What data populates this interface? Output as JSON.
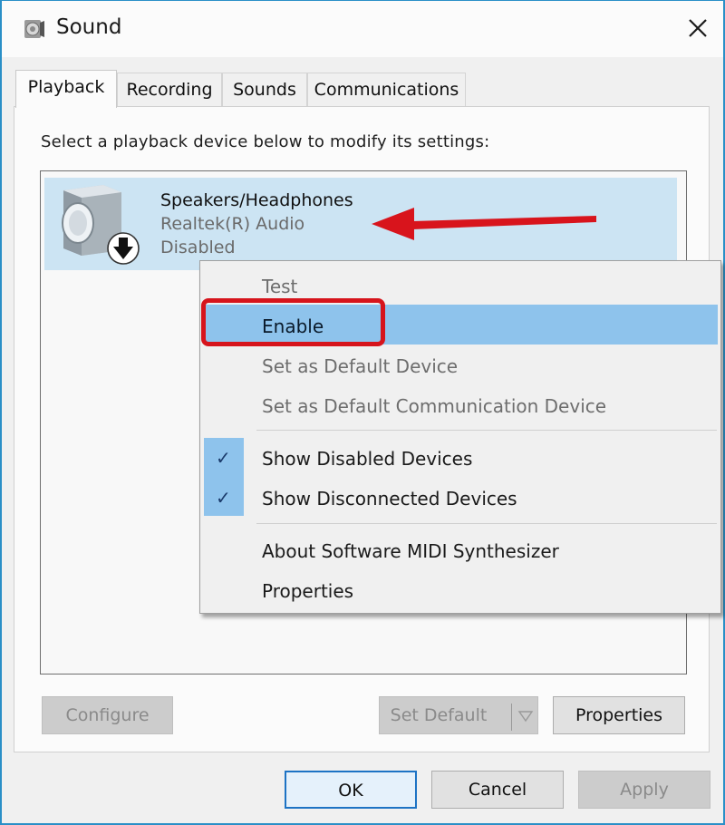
{
  "window": {
    "title": "Sound",
    "close_label": "✕"
  },
  "tabs": [
    {
      "label": "Playback",
      "active": true
    },
    {
      "label": "Recording",
      "active": false
    },
    {
      "label": "Sounds",
      "active": false
    },
    {
      "label": "Communications",
      "active": false
    }
  ],
  "playback": {
    "instructions": "Select a playback device below to modify its settings:",
    "devices": [
      {
        "name": "Speakers/Headphones",
        "driver": "Realtek(R) Audio",
        "status": "Disabled",
        "icon": "speaker-icon",
        "status_icon": "down-arrow-icon"
      }
    ]
  },
  "context_menu": {
    "items": [
      {
        "label": "Test",
        "enabled": false
      },
      {
        "label": "Enable",
        "enabled": true,
        "highlighted": true
      },
      {
        "label": "Set as Default Device",
        "enabled": false
      },
      {
        "label": "Set as Default Communication Device",
        "enabled": false
      },
      {
        "label": "Show Disabled Devices",
        "enabled": true,
        "checked": true
      },
      {
        "label": "Show Disconnected Devices",
        "enabled": true,
        "checked": true
      },
      {
        "label": "About Software MIDI Synthesizer",
        "enabled": true
      },
      {
        "label": "Properties",
        "enabled": true
      }
    ],
    "check_glyph": "✓"
  },
  "buttons": {
    "configure": "Configure",
    "set_default": "Set Default",
    "properties": "Properties",
    "ok": "OK",
    "cancel": "Cancel",
    "apply": "Apply"
  },
  "annotation": {
    "color": "#d6141c"
  }
}
